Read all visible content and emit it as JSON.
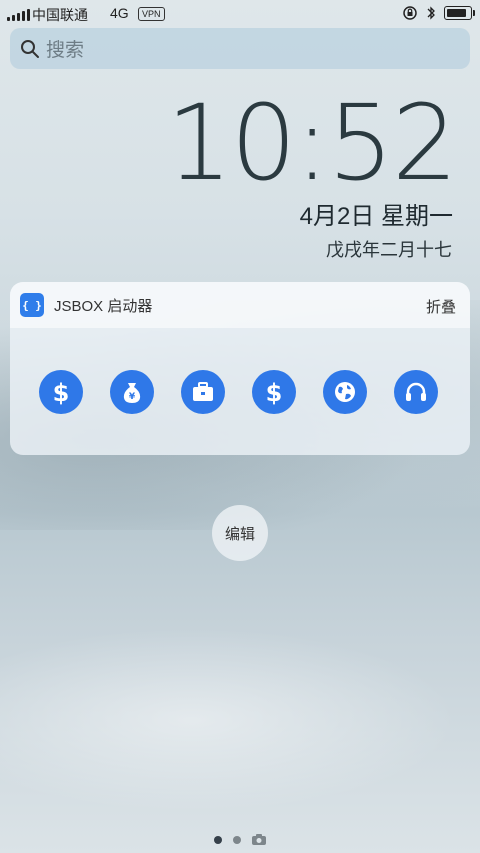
{
  "status_bar": {
    "carrier": "中国联通",
    "network": "4G",
    "vpn": "VPN",
    "battery_level": 0.85
  },
  "search": {
    "placeholder": "搜索"
  },
  "lock": {
    "time": "10:52",
    "date": "4月2日 星期一",
    "lunar": "戊戌年二月十七"
  },
  "widget": {
    "app_name": "JSBOX 启动器",
    "collapse_label": "折叠",
    "icons": [
      {
        "name": "dollar-icon"
      },
      {
        "name": "money-bag-icon"
      },
      {
        "name": "briefcase-icon"
      },
      {
        "name": "dollar-icon"
      },
      {
        "name": "globe-icon"
      },
      {
        "name": "headphones-icon"
      }
    ]
  },
  "edit_label": "编辑",
  "pager": {
    "pages": 2,
    "active": 0,
    "camera": true
  },
  "colors": {
    "accent": "#2f78e8"
  }
}
